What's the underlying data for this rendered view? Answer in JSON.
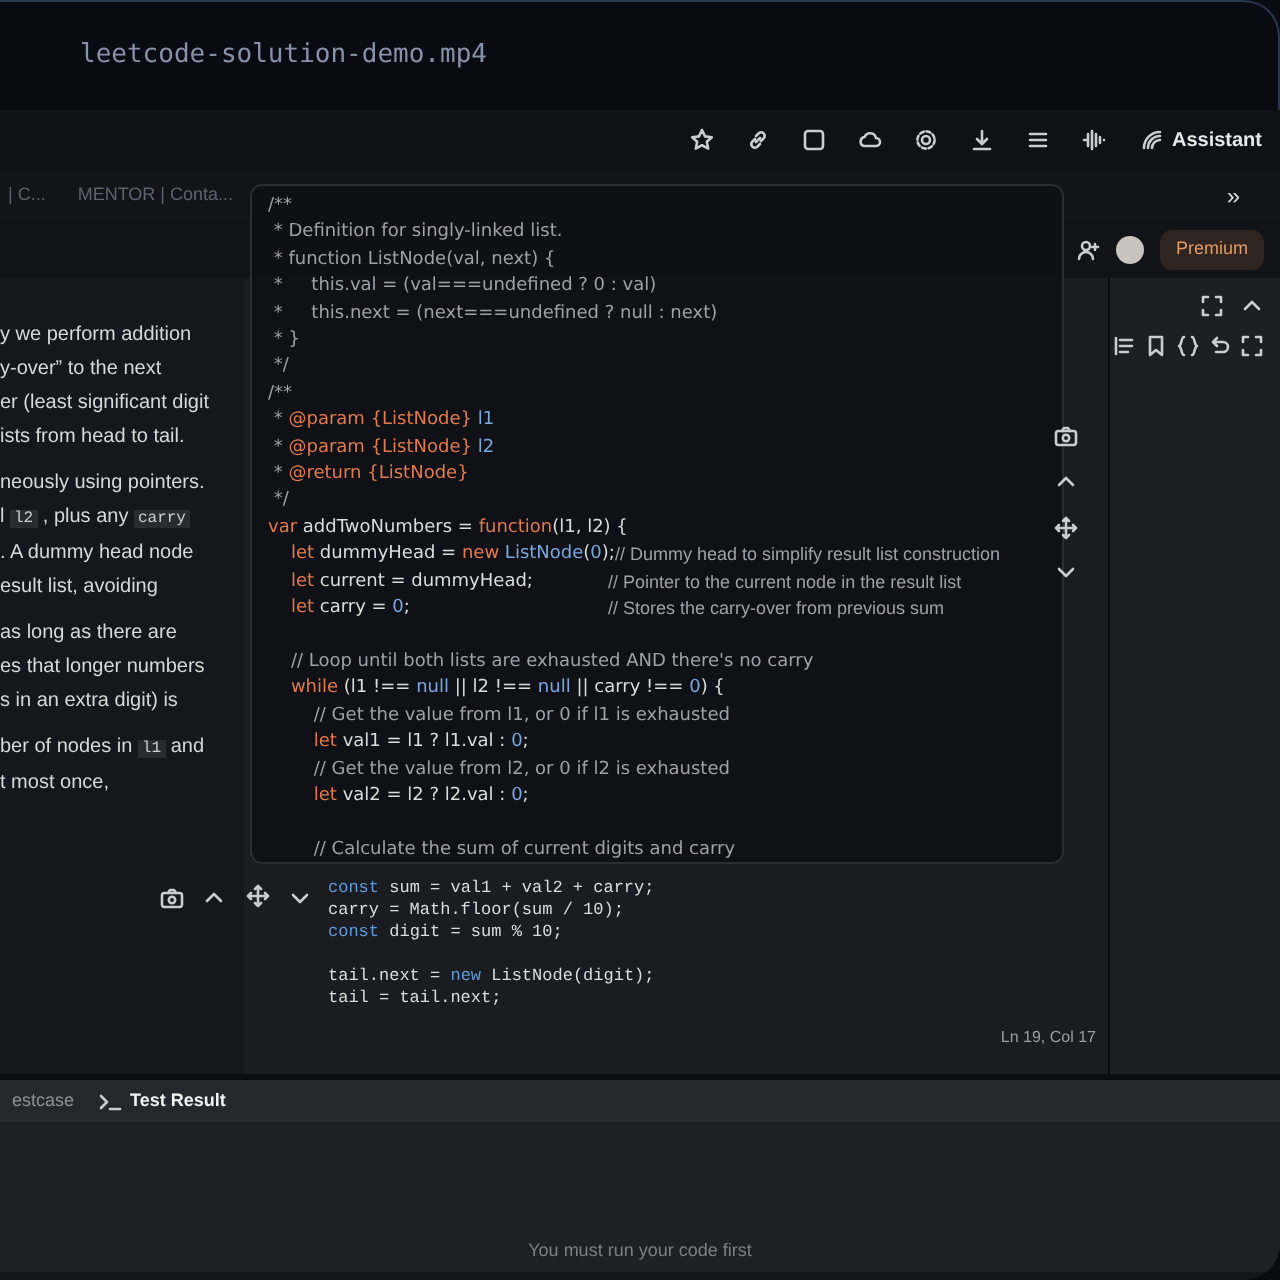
{
  "video_title": "leetcode-solution-demo.mp4",
  "browser_toolbar": {
    "assistant_label": "Assistant"
  },
  "bookmarks": [
    {
      "label": "| C..."
    },
    {
      "label": "MENTOR | Conta..."
    }
  ],
  "bookmarks_more": "»",
  "premium_label": "Premium",
  "description_lines": [
    {
      "segments": [
        {
          "kind": "text",
          "text": "y we perform addition"
        }
      ]
    },
    {
      "segments": [
        {
          "kind": "text",
          "text": "y-over” to the next"
        }
      ]
    },
    {
      "segments": [
        {
          "kind": "text",
          "text": "er (least significant digit"
        }
      ]
    },
    {
      "segments": [
        {
          "kind": "text",
          "text": "ists from head to tail."
        }
      ]
    },
    {
      "segments": [
        {
          "kind": "text",
          "text": "neously using pointers."
        }
      ]
    },
    {
      "segments": [
        {
          "kind": "text",
          "text": "l "
        },
        {
          "kind": "code",
          "text": "l2"
        },
        {
          "kind": "text",
          "text": " , plus any "
        },
        {
          "kind": "code",
          "text": "carry"
        }
      ]
    },
    {
      "segments": [
        {
          "kind": "text",
          "text": ". A dummy head node"
        }
      ]
    },
    {
      "segments": [
        {
          "kind": "text",
          "text": "esult list, avoiding"
        }
      ]
    },
    {
      "segments": [
        {
          "kind": "text",
          "text": "as long as there are"
        }
      ]
    },
    {
      "segments": [
        {
          "kind": "text",
          "text": "es that longer numbers"
        }
      ]
    },
    {
      "segments": [
        {
          "kind": "text",
          "text": "s in an extra digit) is"
        }
      ]
    },
    {
      "segments": [
        {
          "kind": "text",
          "text": "ber of nodes in "
        },
        {
          "kind": "code",
          "text": "l1"
        },
        {
          "kind": "text",
          "text": " and"
        }
      ]
    },
    {
      "segments": [
        {
          "kind": "text",
          "text": "t most once,"
        }
      ]
    }
  ],
  "code_overlay": {
    "lines": [
      {
        "tokens": [
          {
            "kind": "comment",
            "text": "/**"
          }
        ]
      },
      {
        "tokens": [
          {
            "kind": "comment",
            "text": " * Definition for singly-linked list."
          }
        ]
      },
      {
        "tokens": [
          {
            "kind": "comment",
            "text": " * function ListNode(val, next) {"
          }
        ]
      },
      {
        "tokens": [
          {
            "kind": "comment",
            "text": " *     this.val = (val===undefined ? 0 : val)"
          }
        ]
      },
      {
        "tokens": [
          {
            "kind": "comment",
            "text": " *     this.next = (next===undefined ? null : next)"
          }
        ]
      },
      {
        "tokens": [
          {
            "kind": "comment",
            "text": " * }"
          }
        ]
      },
      {
        "tokens": [
          {
            "kind": "comment",
            "text": " */"
          }
        ]
      },
      {
        "tokens": [
          {
            "kind": "comment",
            "text": "/**"
          }
        ]
      },
      {
        "tokens": [
          {
            "kind": "comment",
            "text": " * "
          },
          {
            "kind": "keyword",
            "text": "@param"
          },
          {
            "kind": "keyword",
            "text": " {ListNode}"
          },
          {
            "kind": "type",
            "text": " l1"
          }
        ]
      },
      {
        "tokens": [
          {
            "kind": "comment",
            "text": " * "
          },
          {
            "kind": "keyword",
            "text": "@param"
          },
          {
            "kind": "keyword",
            "text": " {ListNode}"
          },
          {
            "kind": "type",
            "text": " l2"
          }
        ]
      },
      {
        "tokens": [
          {
            "kind": "comment",
            "text": " * "
          },
          {
            "kind": "keyword",
            "text": "@return"
          },
          {
            "kind": "keyword",
            "text": " {ListNode}"
          }
        ]
      },
      {
        "tokens": [
          {
            "kind": "comment",
            "text": " */"
          }
        ]
      },
      {
        "tokens": [
          {
            "kind": "keyword",
            "text": "var"
          },
          {
            "kind": "plain",
            "text": " addTwoNumbers = "
          },
          {
            "kind": "keyword",
            "text": "function"
          },
          {
            "kind": "plain",
            "text": "(l1, l2) {"
          }
        ]
      },
      {
        "tokens": [
          {
            "kind": "keyword",
            "text": "    let"
          },
          {
            "kind": "plain",
            "text": " dummyHead = "
          },
          {
            "kind": "keyword",
            "text": "new"
          },
          {
            "kind": "type",
            "text": " ListNode"
          },
          {
            "kind": "plain",
            "text": "("
          },
          {
            "kind": "type",
            "text": "0"
          },
          {
            "kind": "plain",
            "text": ");"
          }
        ],
        "note": "// Dummy head to simplify result list construction"
      },
      {
        "tokens": [
          {
            "kind": "keyword",
            "text": "    let"
          },
          {
            "kind": "plain",
            "text": " current = dummyHead;"
          }
        ],
        "note": "// Pointer to the current node in the result list"
      },
      {
        "tokens": [
          {
            "kind": "keyword",
            "text": "    let"
          },
          {
            "kind": "plain",
            "text": " carry = "
          },
          {
            "kind": "type",
            "text": "0"
          },
          {
            "kind": "plain",
            "text": ";"
          }
        ],
        "note": "// Stores the carry-over from previous sum"
      },
      {
        "kind": "blank"
      },
      {
        "tokens": [
          {
            "kind": "comment",
            "text": "    // Loop until both lists are exhausted AND there's no carry"
          }
        ]
      },
      {
        "tokens": [
          {
            "kind": "keyword",
            "text": "    while"
          },
          {
            "kind": "plain",
            "text": " (l1 !== "
          },
          {
            "kind": "type",
            "text": "null"
          },
          {
            "kind": "plain",
            "text": " || l2 !== "
          },
          {
            "kind": "type",
            "text": "null"
          },
          {
            "kind": "plain",
            "text": " || carry !== "
          },
          {
            "kind": "type",
            "text": "0"
          },
          {
            "kind": "plain",
            "text": ") {"
          }
        ]
      },
      {
        "tokens": [
          {
            "kind": "comment",
            "text": "        // Get the value from l1, or 0 if l1 is exhausted"
          }
        ]
      },
      {
        "tokens": [
          {
            "kind": "keyword",
            "text": "        let"
          },
          {
            "kind": "plain",
            "text": " val1 = l1 ? l1.val : "
          },
          {
            "kind": "type",
            "text": "0"
          },
          {
            "kind": "plain",
            "text": ";"
          }
        ]
      },
      {
        "tokens": [
          {
            "kind": "comment",
            "text": "        // Get the value from l2, or 0 if l2 is exhausted"
          }
        ]
      },
      {
        "tokens": [
          {
            "kind": "keyword",
            "text": "        let"
          },
          {
            "kind": "plain",
            "text": " val2 = l2 ? l2.val : "
          },
          {
            "kind": "type",
            "text": "0"
          },
          {
            "kind": "plain",
            "text": ";"
          }
        ]
      },
      {
        "kind": "blank"
      },
      {
        "tokens": [
          {
            "kind": "comment",
            "text": "        // Calculate the sum of current digits and carry"
          }
        ]
      }
    ]
  },
  "editor": {
    "lines": [
      {
        "tokens": [
          {
            "kind": "keyword",
            "text": "const"
          },
          {
            "kind": "plain",
            "text": " sum = val1 + val2 + carry;"
          }
        ]
      },
      {
        "tokens": [
          {
            "kind": "plain",
            "text": "carry = Math.floor(sum / 10);"
          }
        ]
      },
      {
        "tokens": [
          {
            "kind": "keyword",
            "text": "const"
          },
          {
            "kind": "plain",
            "text": " digit = sum % 10;"
          }
        ]
      },
      {
        "kind": "blank"
      },
      {
        "tokens": [
          {
            "kind": "plain",
            "text": "tail.next = "
          },
          {
            "kind": "keyword",
            "text": "new"
          },
          {
            "kind": "plain",
            "text": " ListNode(digit);"
          }
        ]
      },
      {
        "tokens": [
          {
            "kind": "plain",
            "text": "tail = tail.next;"
          }
        ]
      }
    ],
    "status": "Ln 19, Col 17"
  },
  "bottom_panel": {
    "tabs": [
      {
        "label": "estcase",
        "selected": false
      },
      {
        "label": "Test Result",
        "selected": true
      }
    ],
    "message": "You must run your code first"
  }
}
